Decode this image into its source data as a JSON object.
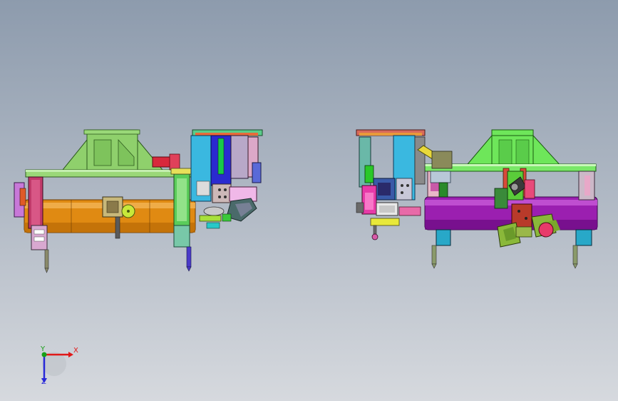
{
  "viewport": {
    "background_top": "#8d9bad",
    "background_bottom": "#d6d9de"
  },
  "models": [
    {
      "id": "left-assembly",
      "main_cylinder_color": "#e08a12",
      "frame_color": "#8fd06c"
    },
    {
      "id": "right-assembly",
      "main_cylinder_color": "#9b1fb0",
      "frame_color": "#6ee65a"
    }
  ],
  "triad": {
    "x_label": "X",
    "y_label": "Y",
    "z_label": "Z",
    "x_color": "#e01818",
    "y_color": "#18a018",
    "z_color": "#2828d8"
  }
}
